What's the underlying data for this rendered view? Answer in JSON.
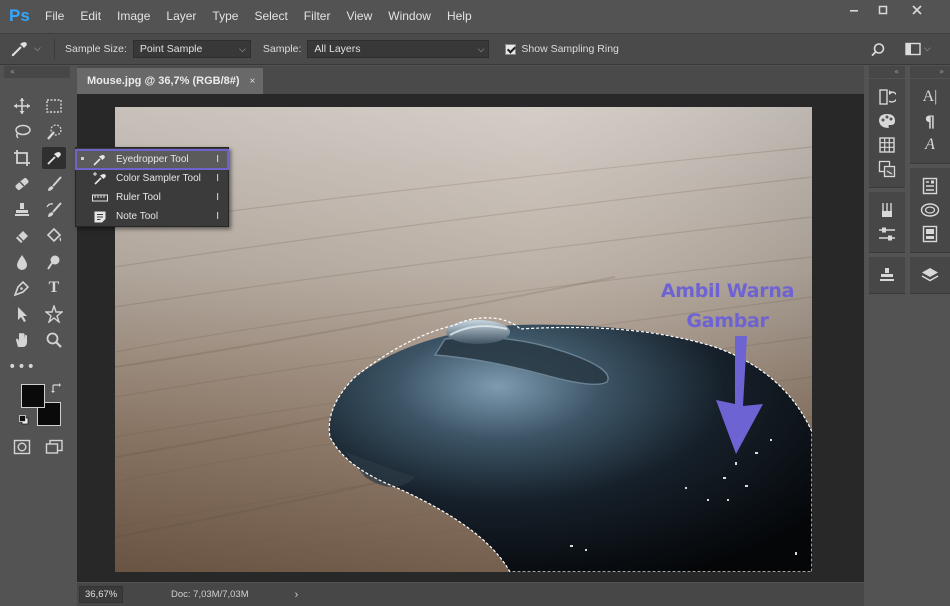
{
  "app": {
    "logo": "Ps",
    "menu": [
      "File",
      "Edit",
      "Image",
      "Layer",
      "Type",
      "Select",
      "Filter",
      "View",
      "Window",
      "Help"
    ],
    "window_controls": [
      "minimize-icon",
      "maximize-icon",
      "close-icon"
    ]
  },
  "options": {
    "sample_size_label": "Sample Size:",
    "sample_size_value": "Point Sample",
    "sample_label": "Sample:",
    "sample_value": "All Layers",
    "show_ring_label": "Show Sampling Ring",
    "show_ring_checked": true
  },
  "document": {
    "tab_title": "Mouse.jpg @ 36,7% (RGB/8#)",
    "tab_close": "×",
    "zoom": "36,67%",
    "doc_info": "Doc: 7,03M/7,03M"
  },
  "flyout": {
    "items": [
      {
        "label": "Eyedropper Tool",
        "key": "I",
        "icon": "eyedropper-icon",
        "active": true
      },
      {
        "label": "Color Sampler Tool",
        "key": "I",
        "icon": "color-sampler-icon",
        "active": false
      },
      {
        "label": "Ruler Tool",
        "key": "I",
        "icon": "ruler-icon",
        "active": false
      },
      {
        "label": "Note Tool",
        "key": "I",
        "icon": "note-icon",
        "active": false
      }
    ]
  },
  "annotation": {
    "line1": "Ambil Warna",
    "line2": "Gambar",
    "color": "#6e63d2"
  },
  "colors": {
    "foreground": "#0a0a0a",
    "background": "#0a0a0a"
  }
}
